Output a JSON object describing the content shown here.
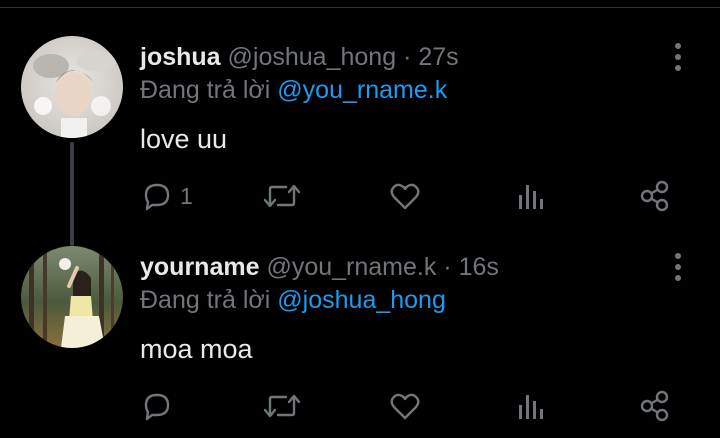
{
  "tweets": [
    {
      "display_name": "joshua",
      "handle": "@joshua_hong",
      "time": "27s",
      "reply_prefix": "Đang trả lời",
      "reply_to": "@you_rname.k",
      "text": "love uu",
      "reply_count": "1"
    },
    {
      "display_name": "yourname",
      "handle": "@you_rname.k",
      "time": "16s",
      "reply_prefix": "Đang trả lời",
      "reply_to": "@joshua_hong",
      "text": "moa moa",
      "reply_count": ""
    }
  ],
  "separator": "·",
  "icons": {
    "reply": "reply-icon",
    "retweet": "retweet-icon",
    "like": "heart-icon",
    "views": "views-icon",
    "share": "share-icon",
    "more": "more-vertical-icon"
  },
  "colors": {
    "background": "#000000",
    "text": "#e7e9ea",
    "muted": "#71767b",
    "link": "#1d9bf0",
    "thread_line": "#3a3d41"
  }
}
